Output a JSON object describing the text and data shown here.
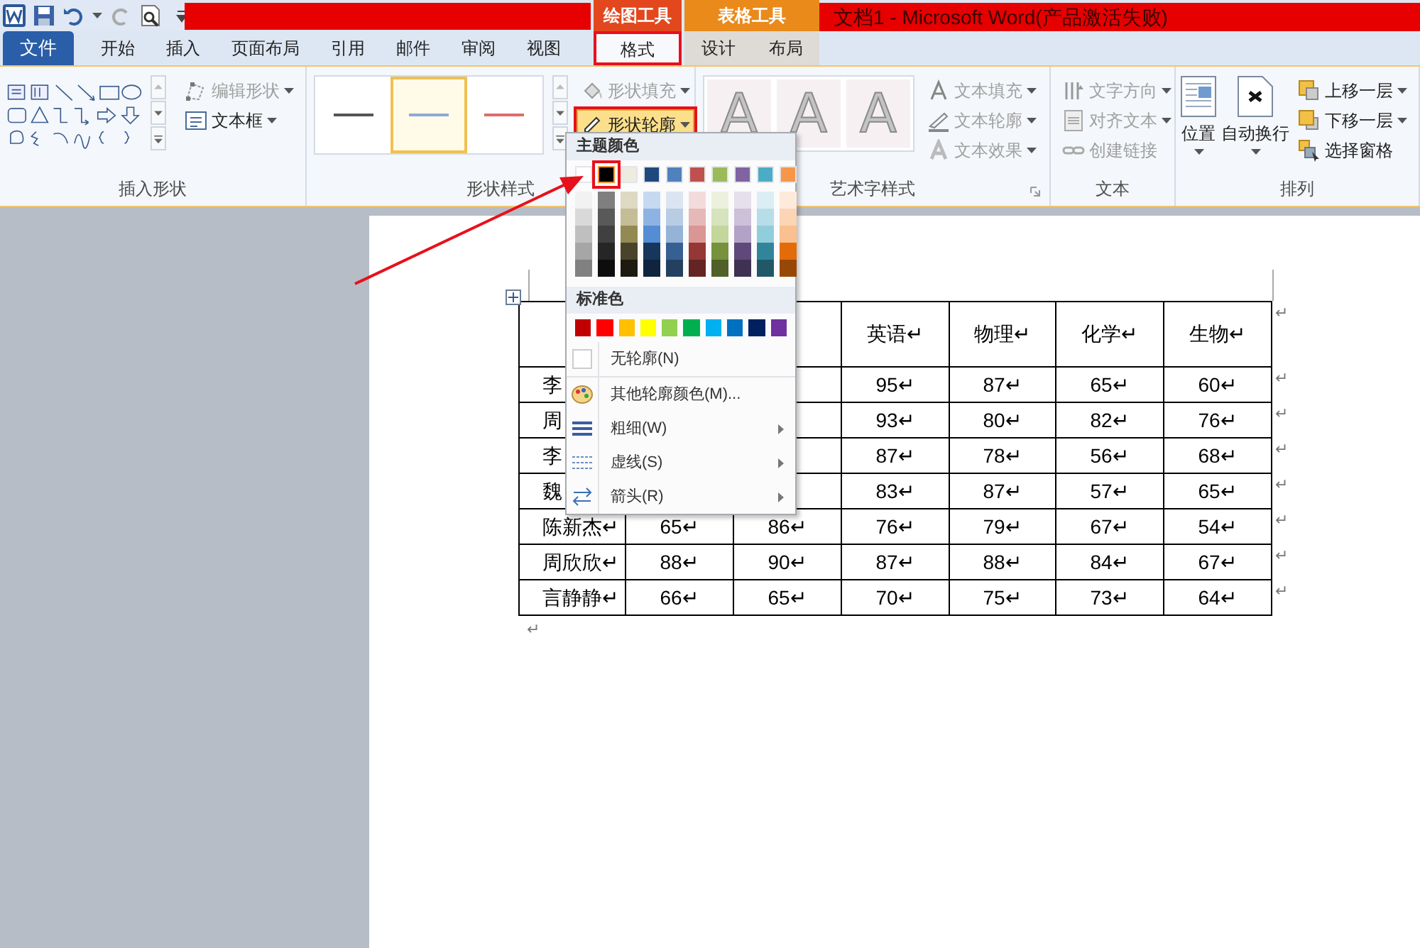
{
  "title_bar": {
    "title": "文档1 - Microsoft Word(产品激活失败)"
  },
  "file_tab": {
    "label": "文件"
  },
  "tabs": [
    {
      "label": "开始",
      "selected": false
    },
    {
      "label": "插入",
      "selected": false
    },
    {
      "label": "页面布局",
      "selected": false
    },
    {
      "label": "引用",
      "selected": false
    },
    {
      "label": "邮件",
      "selected": false
    },
    {
      "label": "审阅",
      "selected": false
    },
    {
      "label": "视图",
      "selected": false
    }
  ],
  "context_groups": [
    {
      "label": "绘图工具",
      "color": "#e2471d",
      "tabs": [
        {
          "label": "格式",
          "selected": true,
          "callout": true
        }
      ]
    },
    {
      "label": "表格工具",
      "color": "#e98a1b",
      "tabs": [
        {
          "label": "设计",
          "selected": false,
          "callout": false
        },
        {
          "label": "布局",
          "selected": false,
          "callout": false
        }
      ]
    }
  ],
  "ribbon": {
    "groups": [
      {
        "kind": "insert_shapes",
        "label": "插入形状",
        "commands": [
          {
            "label": "编辑形状",
            "disabled": true
          },
          {
            "label": "文本框",
            "disabled": false
          }
        ]
      },
      {
        "kind": "shape_styles",
        "label": "形状样式",
        "styles": [
          {
            "color": "#555555",
            "selected": false
          },
          {
            "color": "#8ea9d8",
            "selected": true
          },
          {
            "color": "#e06c6c",
            "selected": false
          }
        ],
        "commands": [
          {
            "label": "形状填充",
            "disabled": true,
            "active": false,
            "callout": false
          },
          {
            "label": "形状轮廓",
            "disabled": false,
            "active": true,
            "callout": true
          }
        ]
      },
      {
        "kind": "wordart_styles",
        "label": "艺术字样式",
        "styles": [
          {
            "letter": "A"
          },
          {
            "letter": "A"
          },
          {
            "letter": "A"
          }
        ],
        "commands": [
          {
            "label": "文本填充",
            "disabled": true
          },
          {
            "label": "文本轮廓",
            "disabled": true
          },
          {
            "label": "文本效果",
            "disabled": true
          }
        ]
      },
      {
        "kind": "text",
        "label": "文本",
        "commands": [
          {
            "label": "文字方向",
            "disabled": true
          },
          {
            "label": "对齐文本",
            "disabled": true
          },
          {
            "label": "创建链接",
            "disabled": true
          }
        ]
      },
      {
        "kind": "arrange",
        "label": "排列",
        "large": [
          {
            "label": "位置"
          },
          {
            "label": "自动换行"
          }
        ],
        "commands": [
          {
            "label": "上移一层",
            "disabled": false
          },
          {
            "label": "下移一层",
            "disabled": false
          },
          {
            "label": "选择窗格",
            "disabled": false
          }
        ]
      }
    ]
  },
  "outline_menu": {
    "theme_heading": "主题颜色",
    "theme_colors": [
      {
        "color": "#ffffff",
        "selected": false,
        "callout": false,
        "shades": [
          {
            "color": "#f2f2f2"
          },
          {
            "color": "#d9d9d9"
          },
          {
            "color": "#bfbfbf"
          },
          {
            "color": "#a6a6a6"
          },
          {
            "color": "#808080"
          }
        ]
      },
      {
        "color": "#000000",
        "selected": true,
        "callout": true,
        "shades": [
          {
            "color": "#7f7f7f"
          },
          {
            "color": "#595959"
          },
          {
            "color": "#404040"
          },
          {
            "color": "#262626"
          },
          {
            "color": "#0d0d0d"
          }
        ]
      },
      {
        "color": "#eeece1",
        "selected": false,
        "callout": false,
        "shades": [
          {
            "color": "#ddd9c3"
          },
          {
            "color": "#c4bd97"
          },
          {
            "color": "#938953"
          },
          {
            "color": "#494429"
          },
          {
            "color": "#1d1b10"
          }
        ]
      },
      {
        "color": "#1f497d",
        "selected": false,
        "callout": false,
        "shades": [
          {
            "color": "#c6d9f0"
          },
          {
            "color": "#8db3e2"
          },
          {
            "color": "#548dd4"
          },
          {
            "color": "#17365d"
          },
          {
            "color": "#0f243e"
          }
        ]
      },
      {
        "color": "#4f81bd",
        "selected": false,
        "callout": false,
        "shades": [
          {
            "color": "#dbe5f1"
          },
          {
            "color": "#b8cce4"
          },
          {
            "color": "#95b3d7"
          },
          {
            "color": "#366092"
          },
          {
            "color": "#244061"
          }
        ]
      },
      {
        "color": "#c0504d",
        "selected": false,
        "callout": false,
        "shades": [
          {
            "color": "#f2dcdb"
          },
          {
            "color": "#e5b9b7"
          },
          {
            "color": "#d99694"
          },
          {
            "color": "#953734"
          },
          {
            "color": "#632423"
          }
        ]
      },
      {
        "color": "#9bbb59",
        "selected": false,
        "callout": false,
        "shades": [
          {
            "color": "#ebf1dd"
          },
          {
            "color": "#d7e3bc"
          },
          {
            "color": "#c3d69b"
          },
          {
            "color": "#76923c"
          },
          {
            "color": "#4f6128"
          }
        ]
      },
      {
        "color": "#8064a2",
        "selected": false,
        "callout": false,
        "shades": [
          {
            "color": "#e5e0ec"
          },
          {
            "color": "#ccc1d9"
          },
          {
            "color": "#b2a2c7"
          },
          {
            "color": "#5f497a"
          },
          {
            "color": "#3f3151"
          }
        ]
      },
      {
        "color": "#4bacc6",
        "selected": false,
        "callout": false,
        "shades": [
          {
            "color": "#dbeef3"
          },
          {
            "color": "#b7dde8"
          },
          {
            "color": "#92cddc"
          },
          {
            "color": "#31859b"
          },
          {
            "color": "#205867"
          }
        ]
      },
      {
        "color": "#f79646",
        "selected": false,
        "callout": false,
        "shades": [
          {
            "color": "#fdeada"
          },
          {
            "color": "#fbd5b5"
          },
          {
            "color": "#fac08f"
          },
          {
            "color": "#e36c09"
          },
          {
            "color": "#974806"
          }
        ]
      }
    ],
    "standard_heading": "标准色",
    "standard_colors": [
      {
        "color": "#c00000"
      },
      {
        "color": "#ff0000"
      },
      {
        "color": "#ffc000"
      },
      {
        "color": "#ffff00"
      },
      {
        "color": "#92d050"
      },
      {
        "color": "#00b050"
      },
      {
        "color": "#00b0f0"
      },
      {
        "color": "#0070c0"
      },
      {
        "color": "#002060"
      },
      {
        "color": "#7030a0"
      }
    ],
    "items": [
      {
        "kind": "no_outline",
        "label": "无轮廓(N)",
        "submenu": false
      },
      {
        "kind": "more_colors",
        "label": "其他轮廓颜色(M)...",
        "submenu": false
      },
      {
        "kind": "weight",
        "label": "粗细(W)",
        "submenu": true
      },
      {
        "kind": "dashes",
        "label": "虚线(S)",
        "submenu": true
      },
      {
        "kind": "arrows",
        "label": "箭头(R)",
        "submenu": true
      }
    ]
  },
  "table": {
    "header": {
      "cells": [
        null,
        null,
        null,
        "英语↵",
        "物理↵",
        "化学↵",
        "生物↵"
      ],
      "end_mark": "↵"
    },
    "rows": [
      {
        "cells": [
          "李",
          null,
          null,
          "95↵",
          "87↵",
          "65↵",
          "60↵"
        ],
        "end_mark": "↵"
      },
      {
        "cells": [
          "周",
          null,
          null,
          "93↵",
          "80↵",
          "82↵",
          "76↵"
        ],
        "end_mark": "↵"
      },
      {
        "cells": [
          "李",
          null,
          null,
          "87↵",
          "78↵",
          "56↵",
          "68↵"
        ],
        "end_mark": "↵"
      },
      {
        "cells": [
          "魏",
          null,
          null,
          "83↵",
          "87↵",
          "57↵",
          "65↵"
        ],
        "end_mark": "↵"
      },
      {
        "cells": [
          "陈新杰↵",
          "65↵",
          "86↵",
          "76↵",
          "79↵",
          "67↵",
          "54↵"
        ],
        "end_mark": "↵"
      },
      {
        "cells": [
          "周欣欣↵",
          "88↵",
          "90↵",
          "87↵",
          "88↵",
          "84↵",
          "67↵"
        ],
        "end_mark": "↵"
      },
      {
        "cells": [
          "言静静↵",
          "66↵",
          "65↵",
          "70↵",
          "75↵",
          "73↵",
          "64↵"
        ],
        "end_mark": "↵"
      }
    ],
    "after_mark": "↵"
  }
}
